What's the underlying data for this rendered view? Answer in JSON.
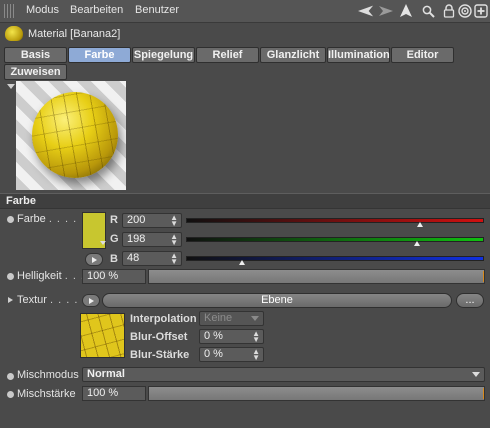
{
  "menu": {
    "items": [
      "Modus",
      "Bearbeiten",
      "Benutzer"
    ]
  },
  "toolbar_icons": [
    "arrow-back-icon",
    "arrow-forward-icon",
    "cursor-up-icon",
    "search-icon",
    "lock-icon",
    "target-icon",
    "new-window-icon"
  ],
  "material": {
    "title": "Material [Banana2]"
  },
  "tabs": {
    "row1": [
      "Basis",
      "Farbe",
      "Spiegelung",
      "Relief",
      "Glanzlicht",
      "Illumination",
      "Editor"
    ],
    "row2": [
      "Zuweisen"
    ],
    "active": "Farbe"
  },
  "section": {
    "title": "Farbe"
  },
  "color": {
    "label": "Farbe",
    "dots": ". . . .",
    "swatch": "#c8c62f",
    "channels": [
      {
        "name": "R",
        "value": "200",
        "level": 0.784,
        "color": "#d01010"
      },
      {
        "name": "G",
        "value": "198",
        "level": 0.776,
        "color": "#10c010"
      },
      {
        "name": "B",
        "value": "48",
        "level": 0.188,
        "color": "#1030e0"
      }
    ]
  },
  "brightness": {
    "label": "Helligkeit",
    "dots": ". . .",
    "value": "100 %",
    "level": 1.0
  },
  "texture": {
    "label": "Textur",
    "dots": ". . . . .",
    "button": "Ebene",
    "more": "...",
    "interpolation_label": "Interpolation",
    "interpolation_value": "Keine",
    "blur_offset_label": "Blur-Offset",
    "blur_offset_value": "0 %",
    "blur_strength_label": "Blur-Stärke",
    "blur_strength_value": "0 %"
  },
  "mix_mode": {
    "label": "Mischmodus",
    "value": "Normal"
  },
  "mix_strength": {
    "label": "Mischstärke",
    "value": "100 %",
    "level": 1.0
  }
}
